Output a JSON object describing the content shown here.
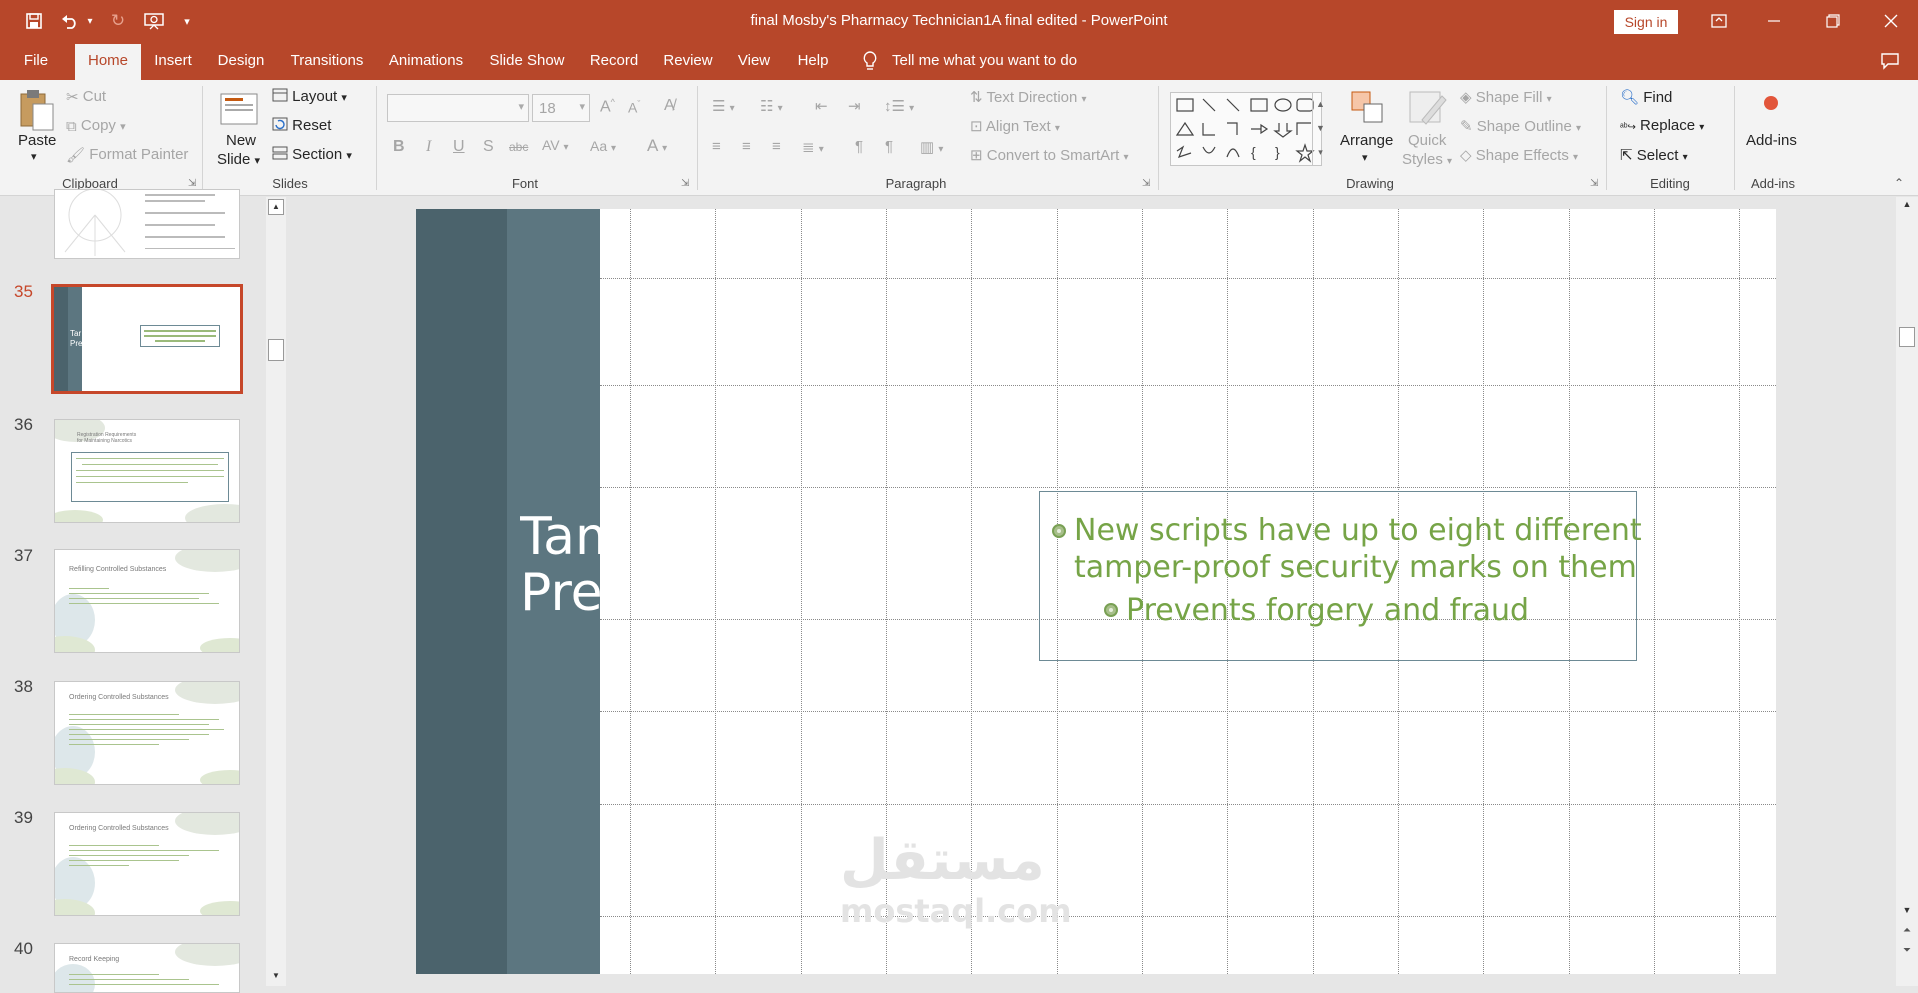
{
  "window": {
    "title": "final Mosby's Pharmacy Technician1A final edited  -  PowerPoint",
    "sign_in": "Sign in"
  },
  "tabs": [
    "File",
    "Home",
    "Insert",
    "Design",
    "Transitions",
    "Animations",
    "Slide Show",
    "Record",
    "Review",
    "View",
    "Help"
  ],
  "tell_me": "Tell me what you want to do",
  "ribbon": {
    "clipboard": {
      "paste": "Paste",
      "cut": "Cut",
      "copy": "Copy",
      "format_painter": "Format Painter",
      "label": "Clipboard"
    },
    "slides": {
      "new_slide_1": "New",
      "new_slide_2": "Slide",
      "layout": "Layout",
      "reset": "Reset",
      "section": "Section",
      "label": "Slides"
    },
    "font": {
      "font_size": "18",
      "label": "Font"
    },
    "paragraph": {
      "text_direction": "Text Direction",
      "align_text": "Align Text",
      "convert_smartart": "Convert to SmartArt",
      "label": "Paragraph"
    },
    "drawing": {
      "arrange": "Arrange",
      "quick_styles_1": "Quick",
      "quick_styles_2": "Styles",
      "shape_fill": "Shape Fill",
      "shape_outline": "Shape Outline",
      "shape_effects": "Shape Effects",
      "label": "Drawing"
    },
    "editing": {
      "find": "Find",
      "replace": "Replace",
      "select": "Select",
      "label": "Editing"
    },
    "addins": {
      "addins": "Add-ins",
      "label": "Add-ins"
    }
  },
  "slides_panel": {
    "numbers": [
      "35",
      "36",
      "37",
      "38",
      "39",
      "40"
    ],
    "thumb_titles": {
      "s36": "Registration Requirements for Maintaining Narcotics",
      "s37": "Refilling Controlled Substances",
      "s38": "Ordering Controlled Substances",
      "s39": "Ordering Controlled Substances",
      "s40": "Record Keeping"
    }
  },
  "slide": {
    "title_line1": "Tam",
    "title_line2": "Pre",
    "bullet1_line1": "New scripts have up to eight different",
    "bullet1_line2": "tamper-proof security marks on them",
    "bullet2": "Prevents forgery and fraud",
    "watermark_ar": "مستقل",
    "watermark_en": "mostaql.com"
  },
  "colors": {
    "accent": "#b7472a",
    "slide_band_dark": "#4b636c",
    "slide_band_light": "#5c7680",
    "bullet_text": "#76a447"
  }
}
